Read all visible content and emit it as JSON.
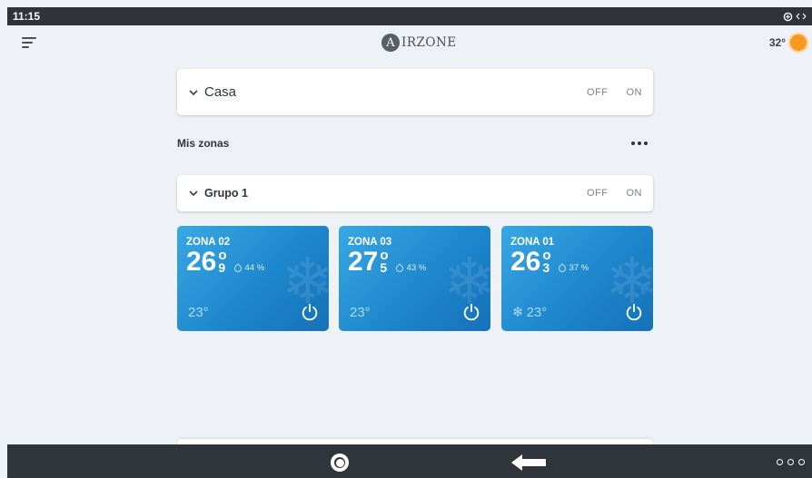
{
  "status": {
    "time": "11:15",
    "icons": [
      "data-saver-icon",
      "sync-arrows-icon"
    ]
  },
  "header": {
    "logo_letter": "A",
    "logo_text": "IRZONE",
    "weather_temp": "32°",
    "weather_icon": "sun-icon"
  },
  "casa": {
    "title": "Casa",
    "off_label": "OFF",
    "on_label": "ON"
  },
  "section": {
    "title": "Mis zonas"
  },
  "grupo": {
    "title": "Grupo 1",
    "off_label": "OFF",
    "on_label": "ON"
  },
  "zones": [
    {
      "name": "ZONA 02",
      "temp_int": "26",
      "temp_deg": "o",
      "temp_frac": "9",
      "humidity": "44 %",
      "setpoint": "23°",
      "cooling": false
    },
    {
      "name": "ZONA 03",
      "temp_int": "27",
      "temp_deg": "o",
      "temp_frac": "5",
      "humidity": "43 %",
      "setpoint": "23°",
      "cooling": false
    },
    {
      "name": "ZONA 01",
      "temp_int": "26",
      "temp_deg": "o",
      "temp_frac": "3",
      "humidity": "37 %",
      "setpoint": "23°",
      "cooling": true
    }
  ],
  "colors": {
    "card_accent": "#1e87cd",
    "sun": "#f89a22",
    "navbar": "#30343b"
  }
}
